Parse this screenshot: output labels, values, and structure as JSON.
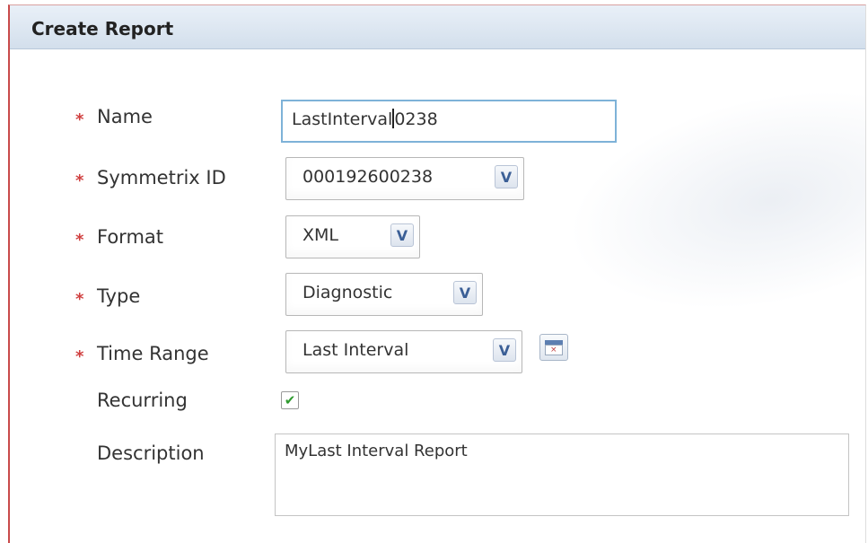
{
  "panel": {
    "title": "Create Report"
  },
  "fields": {
    "name": {
      "label": "Name",
      "value_before_caret": "LastInterval",
      "value_after_caret": "0238",
      "required": true
    },
    "symmetrix": {
      "label": "Symmetrix ID",
      "value": "000192600238",
      "required": true
    },
    "format": {
      "label": "Format",
      "value": "XML",
      "required": true
    },
    "type": {
      "label": "Type",
      "value": "Diagnostic",
      "required": true
    },
    "time_range": {
      "label": "Time Range",
      "value": "Last Interval",
      "required": true
    },
    "recurring": {
      "label": "Recurring",
      "checked": true
    },
    "description": {
      "label": "Description",
      "value": "MyLast Interval Report"
    }
  },
  "required_marker": "*",
  "dropdown_glyph": "V",
  "check_glyph": "✔",
  "icons": {
    "calendar": "calendar-icon"
  },
  "colors": {
    "required": "#d04040",
    "header_bg": "#d9e4f0",
    "focus_border": "#7eb2d8",
    "check": "#2f9a2f"
  }
}
